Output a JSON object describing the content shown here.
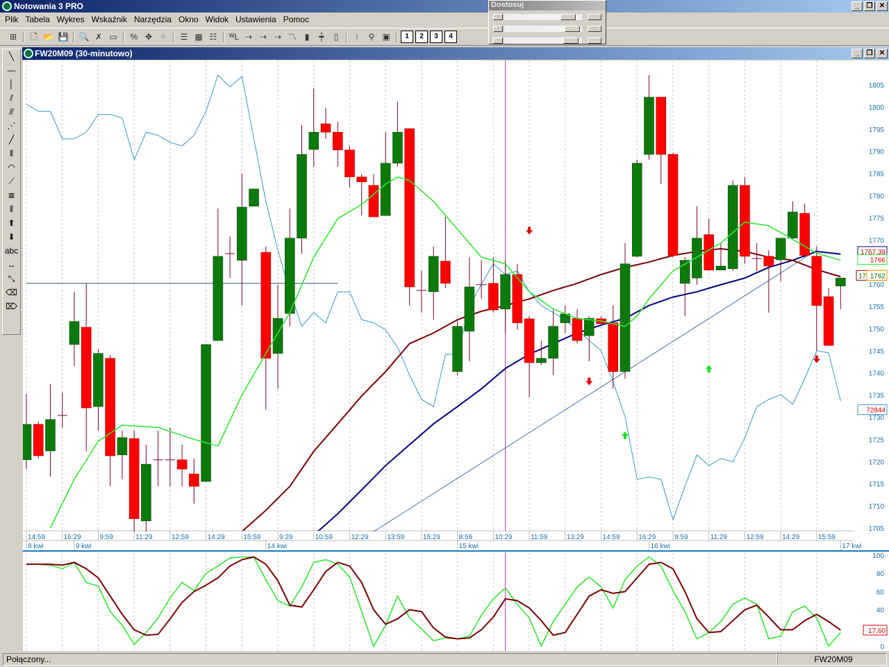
{
  "app": {
    "title": "Notowania 3 PRO",
    "win_buttons": [
      "_",
      "❐",
      "✕"
    ]
  },
  "menu": [
    "Plik",
    "Tabela",
    "Wykres",
    "Wskaźnik",
    "Narzędzia",
    "Okno",
    "Widok",
    "Ustawienia",
    "Pomoc"
  ],
  "toolbar": {
    "icons": [
      {
        "name": "grid-icon",
        "glyph": "⊞"
      },
      {
        "sep": true
      },
      {
        "name": "new-file-icon",
        "glyph": "🗋"
      },
      {
        "name": "open-folder-icon",
        "glyph": "📂"
      },
      {
        "name": "save-icon",
        "glyph": "💾"
      },
      {
        "sep": true
      },
      {
        "name": "zoom-icon",
        "glyph": "🔍"
      },
      {
        "name": "delete-icon",
        "glyph": "✗"
      },
      {
        "name": "ruler-icon",
        "glyph": "▭"
      },
      {
        "sep": true
      },
      {
        "name": "values-icon",
        "glyph": "%"
      },
      {
        "name": "crosshair-icon",
        "glyph": "✥"
      },
      {
        "name": "points-icon",
        "glyph": "⁘"
      },
      {
        "sep": true
      },
      {
        "name": "table-icon",
        "glyph": "☰"
      },
      {
        "name": "layout-icon",
        "glyph": "▦"
      },
      {
        "name": "list-icon",
        "glyph": "☷"
      },
      {
        "sep": true
      },
      {
        "name": "wl-icon",
        "glyph": "ᵂL"
      },
      {
        "name": "arrow-line-icon",
        "glyph": "⇢"
      },
      {
        "name": "arrow-line-2-icon",
        "glyph": "⇢"
      },
      {
        "name": "arrow-line-3-icon",
        "glyph": "⇢"
      },
      {
        "name": "line-chart-icon",
        "glyph": "〽"
      },
      {
        "name": "bar-chart-icon",
        "glyph": "▮"
      },
      {
        "name": "ohlc-icon",
        "glyph": "┿"
      },
      {
        "name": "candle-icon",
        "glyph": "▯"
      },
      {
        "sep": true
      },
      {
        "name": "traffic-light-icon",
        "glyph": "⁝"
      },
      {
        "name": "add-marker-icon",
        "glyph": "⚲"
      },
      {
        "name": "add-window-icon",
        "glyph": "▣"
      },
      {
        "sep": true
      }
    ],
    "layouts": [
      "1",
      "2",
      "3",
      "4"
    ]
  },
  "dostosuj": {
    "title": "Dostosuj",
    "sliders": [
      0.85,
      0.9,
      0.88
    ]
  },
  "chart_window": {
    "title": "FW20M09 (30-minutowo)"
  },
  "left_tools": [
    {
      "name": "line-tool-icon",
      "glyph": "╲"
    },
    {
      "name": "hline-tool-icon",
      "glyph": "—"
    },
    {
      "name": "vline-tool-icon",
      "glyph": "│"
    },
    {
      "name": "channel-tool-icon",
      "glyph": "⫽"
    },
    {
      "name": "fan-tool-icon",
      "glyph": "⫻"
    },
    {
      "name": "gann-tool-icon",
      "glyph": "⋰"
    },
    {
      "name": "ray-tool-icon",
      "glyph": "╱"
    },
    {
      "name": "cycles-tool-icon",
      "glyph": "⦀"
    },
    {
      "name": "arcs-tool-icon",
      "glyph": "◠"
    },
    {
      "name": "speed-tool-icon",
      "glyph": "⟋"
    },
    {
      "name": "fibo-tool-icon",
      "glyph": "≣"
    },
    {
      "name": "timezones-tool-icon",
      "glyph": "⦀"
    },
    {
      "name": "arrow-up-icon",
      "glyph": "⬆"
    },
    {
      "name": "arrow-down-icon",
      "glyph": "⬇"
    },
    {
      "name": "text-tool-icon",
      "glyph": "abc"
    },
    {
      "name": "horizontal-resize-icon",
      "glyph": "↔"
    },
    {
      "name": "diagonal-resize-icon",
      "glyph": "⤡"
    },
    {
      "name": "eraser-icon",
      "glyph": "⌫"
    },
    {
      "name": "eraser-all-icon",
      "glyph": "⌦"
    }
  ],
  "status": {
    "left": "Połączony...",
    "right": "FW20M09"
  },
  "colors": {
    "up": "#0b7a0b",
    "down": "#ff0000",
    "wick": "#7a0028",
    "ma_fast": "#33e633",
    "ma_mid": "#7a0000",
    "ma_slow": "#000080",
    "cyan": "#3399cc",
    "stoch_k": "#33e633",
    "stoch_d": "#7a0000",
    "cursor": "#cc33cc"
  },
  "chart_data": {
    "type": "candlestick",
    "instrument": "FW20M09",
    "interval": "30-minutowo",
    "ylim": [
      1705,
      1805
    ],
    "yticks": [
      1705,
      1710,
      1715,
      1720,
      1725,
      1730,
      1735,
      1740,
      1745,
      1750,
      1755,
      1760,
      1765,
      1770,
      1775,
      1780,
      1785,
      1790,
      1795,
      1800,
      1805
    ],
    "time_labels": [
      "14:59",
      "16:29",
      "9:59",
      "11:29",
      "12:59",
      "14:29",
      "15:59",
      "9:29",
      "10:59",
      "12:29",
      "13:59",
      "15:29",
      "8:59",
      "10:29",
      "11:59",
      "13:29",
      "14:59",
      "16:29",
      "9:59",
      "11:29",
      "12:59",
      "14:29",
      "15:59"
    ],
    "date_labels": [
      {
        "label": "8 kwi",
        "index": 0
      },
      {
        "label": "9 kwi",
        "index": 4
      },
      {
        "label": "14 kwi",
        "index": 20
      },
      {
        "label": "15 kwi",
        "index": 36
      },
      {
        "label": "16 kwi",
        "index": 52
      },
      {
        "label": "17 kwi",
        "index": 68
      }
    ],
    "ohlc": [
      [
        1720.4,
        1735.3,
        1718.3,
        1728.4
      ],
      [
        1728.4,
        1729,
        1720.7,
        1721.3
      ],
      [
        1722.4,
        1737.5,
        1716.6,
        1729.5
      ],
      [
        1730.4,
        1735.6,
        1727.7,
        1730.4
      ],
      [
        1746.4,
        1758.3,
        1741.5,
        1751.6
      ],
      [
        1750.3,
        1760.2,
        1722.3,
        1732.1
      ],
      [
        1732.4,
        1745.3,
        1727,
        1744.4
      ],
      [
        1743.3,
        1744,
        1714.4,
        1721.3
      ],
      [
        1721.5,
        1727,
        1716,
        1725.4
      ],
      [
        1725.2,
        1727,
        1704.2,
        1707.1
      ],
      [
        1706.6,
        1723.8,
        1704.2,
        1719.4
      ],
      [
        1720.4,
        1727,
        1714.4,
        1720.4
      ],
      [
        1720.4,
        1727.7,
        1714.4,
        1720.4
      ],
      [
        1720.4,
        1723.8,
        1714.4,
        1718.3
      ],
      [
        1717.2,
        1720.7,
        1710.5,
        1714.4
      ],
      [
        1715.5,
        1746.4,
        1715.5,
        1746.4
      ],
      [
        1747.3,
        1777.1,
        1747.3,
        1766.3
      ],
      [
        1766.9,
        1770.8,
        1761.4,
        1766.9
      ],
      [
        1765.4,
        1784.9,
        1755.2,
        1777.4
      ],
      [
        1777.6,
        1781.5,
        1777.6,
        1781.5
      ],
      [
        1767.2,
        1768.5,
        1731.7,
        1743.3
      ],
      [
        1744.4,
        1759.9,
        1736.4,
        1752.3
      ],
      [
        1753.4,
        1777.1,
        1750.5,
        1770.4
      ],
      [
        1770.4,
        1795.9,
        1766.9,
        1789.3
      ],
      [
        1790.4,
        1804.2,
        1786.5,
        1794.3
      ],
      [
        1796.2,
        1799.8,
        1792.8,
        1794.3
      ],
      [
        1794.3,
        1796.7,
        1786.5,
        1790.3
      ],
      [
        1790.3,
        1791.2,
        1781.8,
        1784.2
      ],
      [
        1784.2,
        1784.9,
        1775.5,
        1783.1
      ],
      [
        1782.3,
        1784.9,
        1775.5,
        1775.2
      ],
      [
        1775.5,
        1794.3,
        1775.5,
        1787.3
      ],
      [
        1787.3,
        1801.1,
        1786.5,
        1794.3
      ],
      [
        1795.1,
        1795.1,
        1755.2,
        1759.4
      ],
      [
        1758.6,
        1763,
        1753.6,
        1758.6
      ],
      [
        1758.3,
        1768.5,
        1752,
        1766.3
      ],
      [
        1765.2,
        1775.2,
        1759.1,
        1760.2
      ],
      [
        1740.3,
        1752,
        1739.5,
        1750.5
      ],
      [
        1749.4,
        1766.1,
        1742.6,
        1759.4
      ],
      [
        1759.9,
        1765.4,
        1756.7,
        1759.9
      ],
      [
        1760.2,
        1766.1,
        1753.6,
        1754.2
      ],
      [
        1754.4,
        1765.4,
        1748.9,
        1762.2
      ],
      [
        1762.2,
        1764.6,
        1749.7,
        1751.3
      ],
      [
        1752.2,
        1752.8,
        1734.5,
        1742.3
      ],
      [
        1742.3,
        1747.3,
        1741.8,
        1743.3
      ],
      [
        1743.3,
        1754.4,
        1739.5,
        1750.5
      ],
      [
        1751.3,
        1755.2,
        1748.9,
        1753.3
      ],
      [
        1752.3,
        1754.4,
        1746.6,
        1747.3
      ],
      [
        1748.4,
        1752.8,
        1742.6,
        1752.3
      ],
      [
        1752.2,
        1752.8,
        1751.1,
        1751.1
      ],
      [
        1751.3,
        1755.2,
        1736.4,
        1740.3
      ],
      [
        1740.3,
        1769.3,
        1738.7,
        1764.6
      ],
      [
        1766.3,
        1788.1,
        1766.1,
        1787.3
      ],
      [
        1789.3,
        1807.2,
        1788.1,
        1802.2
      ],
      [
        1802.2,
        1802.2,
        1782.6,
        1789.3
      ],
      [
        1789.3,
        1789.6,
        1766.1,
        1766.5
      ],
      [
        1760.2,
        1766.1,
        1752.8,
        1765.4
      ],
      [
        1761.4,
        1777.6,
        1759.9,
        1770.4
      ],
      [
        1771.2,
        1774.8,
        1763,
        1763.2
      ],
      [
        1763.2,
        1769.3,
        1763.2,
        1764.1
      ],
      [
        1763.5,
        1783.4,
        1763,
        1782.3
      ],
      [
        1782.3,
        1784.2,
        1764.6,
        1766.3
      ],
      [
        1765.8,
        1769.3,
        1763,
        1765.8
      ],
      [
        1766.3,
        1767.7,
        1753.6,
        1764.1
      ],
      [
        1765.5,
        1770.4,
        1760.7,
        1770.4
      ],
      [
        1770.4,
        1778.7,
        1770.1,
        1776.3
      ],
      [
        1776,
        1778.2,
        1766.1,
        1766.5
      ],
      [
        1766.3,
        1768.5,
        1745,
        1755.2
      ],
      [
        1757.2,
        1759.1,
        1746.2,
        1746.2
      ],
      [
        1759.6,
        1761.4,
        1754.4,
        1761.4
      ]
    ],
    "ma_fast": [
      [
        2,
        1705
      ],
      [
        4,
        1716
      ],
      [
        6,
        1724.6
      ],
      [
        8,
        1728.2
      ],
      [
        11,
        1727.7
      ],
      [
        14,
        1725
      ],
      [
        16,
        1723.5
      ],
      [
        18,
        1735
      ],
      [
        20,
        1744.4
      ],
      [
        22,
        1753.6
      ],
      [
        24,
        1766.1
      ],
      [
        26,
        1774.8
      ],
      [
        28,
        1778
      ],
      [
        30,
        1782.6
      ],
      [
        31,
        1784.2
      ],
      [
        32,
        1783.4
      ],
      [
        34,
        1778.7
      ],
      [
        36,
        1772.4
      ],
      [
        38,
        1766.1
      ],
      [
        40,
        1764.6
      ],
      [
        42,
        1758.3
      ],
      [
        44,
        1754.4
      ],
      [
        46,
        1752.3
      ],
      [
        48,
        1751.7
      ],
      [
        50,
        1750.5
      ],
      [
        51,
        1752.8
      ],
      [
        52,
        1756.7
      ],
      [
        54,
        1763
      ],
      [
        56,
        1766.1
      ],
      [
        58,
        1769.3
      ],
      [
        60,
        1774
      ],
      [
        62,
        1773.2
      ],
      [
        64,
        1770.1
      ],
      [
        66,
        1767
      ],
      [
        68,
        1765.4
      ]
    ],
    "ma_mid": [
      [
        17,
        1700.3
      ],
      [
        18,
        1704.2
      ],
      [
        20,
        1709
      ],
      [
        22,
        1714.4
      ],
      [
        24,
        1722.3
      ],
      [
        26,
        1728.5
      ],
      [
        28,
        1734.8
      ],
      [
        30,
        1740.3
      ],
      [
        32,
        1746.6
      ],
      [
        34,
        1749
      ],
      [
        36,
        1752
      ],
      [
        38,
        1753.9
      ],
      [
        40,
        1755.2
      ],
      [
        42,
        1756.7
      ],
      [
        44,
        1758.6
      ],
      [
        46,
        1760.2
      ],
      [
        48,
        1762.2
      ],
      [
        50,
        1763.8
      ],
      [
        52,
        1765
      ],
      [
        54,
        1766.5
      ],
      [
        56,
        1767.4
      ],
      [
        58,
        1768
      ],
      [
        60,
        1767.4
      ],
      [
        62,
        1766.1
      ],
      [
        64,
        1765.4
      ],
      [
        66,
        1763.3
      ],
      [
        68,
        1761.7
      ]
    ],
    "ma_slow": [
      [
        23,
        1700.3
      ],
      [
        24,
        1703.4
      ],
      [
        26,
        1708.2
      ],
      [
        28,
        1713.6
      ],
      [
        30,
        1719.1
      ],
      [
        32,
        1723.8
      ],
      [
        34,
        1728.5
      ],
      [
        36,
        1732.4
      ],
      [
        38,
        1736.4
      ],
      [
        40,
        1741
      ],
      [
        42,
        1744.2
      ],
      [
        44,
        1746.6
      ],
      [
        46,
        1749
      ],
      [
        48,
        1750.8
      ],
      [
        50,
        1752.3
      ],
      [
        52,
        1755.2
      ],
      [
        54,
        1757.1
      ],
      [
        56,
        1758.3
      ],
      [
        58,
        1759.9
      ],
      [
        60,
        1761.4
      ],
      [
        62,
        1763.8
      ],
      [
        64,
        1765.4
      ],
      [
        66,
        1767.4
      ],
      [
        68,
        1766.8
      ]
    ],
    "cyan_line": [
      1800.6,
      1799,
      1799,
      1792.8,
      1792.8,
      1794.3,
      1798.3,
      1798.3,
      1797.5,
      1788.1,
      1794.3,
      1793.6,
      1792,
      1791.2,
      1793.6,
      1799,
      1807.2,
      1804.5,
      1806.9,
      1792.8,
      1778.7,
      1767.7,
      1758.3,
      1750.5,
      1753.6,
      1751.3,
      1758.3,
      1758.3,
      1752,
      1751.3,
      1749.7,
      1745.8,
      1739.5,
      1734,
      1732.4,
      1744.2,
      1744.2,
      1755,
      1760,
      1764.6,
      1762.2,
      1763,
      1758.3,
      1755.2,
      1753.6,
      1752,
      1749.7,
      1747.3,
      1745,
      1738,
      1730.1,
      1716,
      1716.5,
      1716,
      1706.9,
      1714.4,
      1721.5,
      1719.1,
      1720.7,
      1719.9,
      1725.4,
      1732.4,
      1734,
      1735.1,
      1732.9,
      1738.7,
      1745,
      1744.5,
      1733.7
    ],
    "hline": {
      "price": 1760.2,
      "from": 0,
      "to": 26
    },
    "trendline": {
      "from": [
        29,
        1704.2
      ],
      "to": [
        66,
        1767.7
      ]
    },
    "cursor_index": 40,
    "signals": [
      {
        "type": "sell",
        "index": 42,
        "price": 1772
      },
      {
        "type": "sell",
        "index": 47,
        "price": 1738
      },
      {
        "type": "sell",
        "index": 66,
        "price": 1743
      },
      {
        "type": "buy",
        "index": 50,
        "price": 1726
      },
      {
        "type": "buy",
        "index": 57,
        "price": 1741
      }
    ],
    "price_labels": [
      {
        "text": "1767.39",
        "border": "#000080",
        "color": "#cc0000"
      },
      {
        "text": "1766",
        "border": "#33e633",
        "color": "#cc0000"
      },
      {
        "text": "1762",
        "border": "#ff9900",
        "color": "#006600",
        "under": "17",
        "under_border": "#7a0000"
      },
      {
        "text": "72844",
        "border": "#3399cc",
        "color": "#cc0000"
      }
    ],
    "stochastic": {
      "ylim": [
        0,
        100
      ],
      "yticks": [
        0,
        20,
        40,
        60,
        80,
        100
      ],
      "k": [
        90,
        90,
        89,
        85,
        92,
        70,
        66,
        38,
        23,
        2,
        15,
        31,
        53,
        70,
        61,
        80,
        88,
        97,
        98,
        98,
        73,
        50,
        44,
        65,
        92,
        95,
        90,
        76,
        38,
        0,
        23,
        55,
        31,
        19,
        6,
        9,
        8,
        11,
        34,
        52,
        64,
        46,
        31,
        0,
        27,
        46,
        65,
        76,
        65,
        42,
        73,
        88,
        98,
        88,
        61,
        38,
        8,
        15,
        27,
        46,
        53,
        46,
        8,
        11,
        38,
        44,
        31,
        0,
        15
      ],
      "d": [
        90,
        90,
        90,
        89,
        92,
        85,
        75,
        55,
        35,
        18,
        12,
        13,
        30,
        48,
        60,
        67,
        75,
        88,
        95,
        98,
        90,
        72,
        45,
        43,
        62,
        82,
        92,
        88,
        70,
        40,
        24,
        30,
        40,
        38,
        20,
        10,
        8,
        9,
        18,
        32,
        52,
        50,
        42,
        28,
        12,
        15,
        35,
        55,
        62,
        58,
        60,
        75,
        90,
        92,
        85,
        60,
        30,
        15,
        16,
        28,
        40,
        45,
        32,
        18,
        18,
        28,
        35,
        27,
        17.6
      ],
      "last_label": "17.60"
    }
  }
}
